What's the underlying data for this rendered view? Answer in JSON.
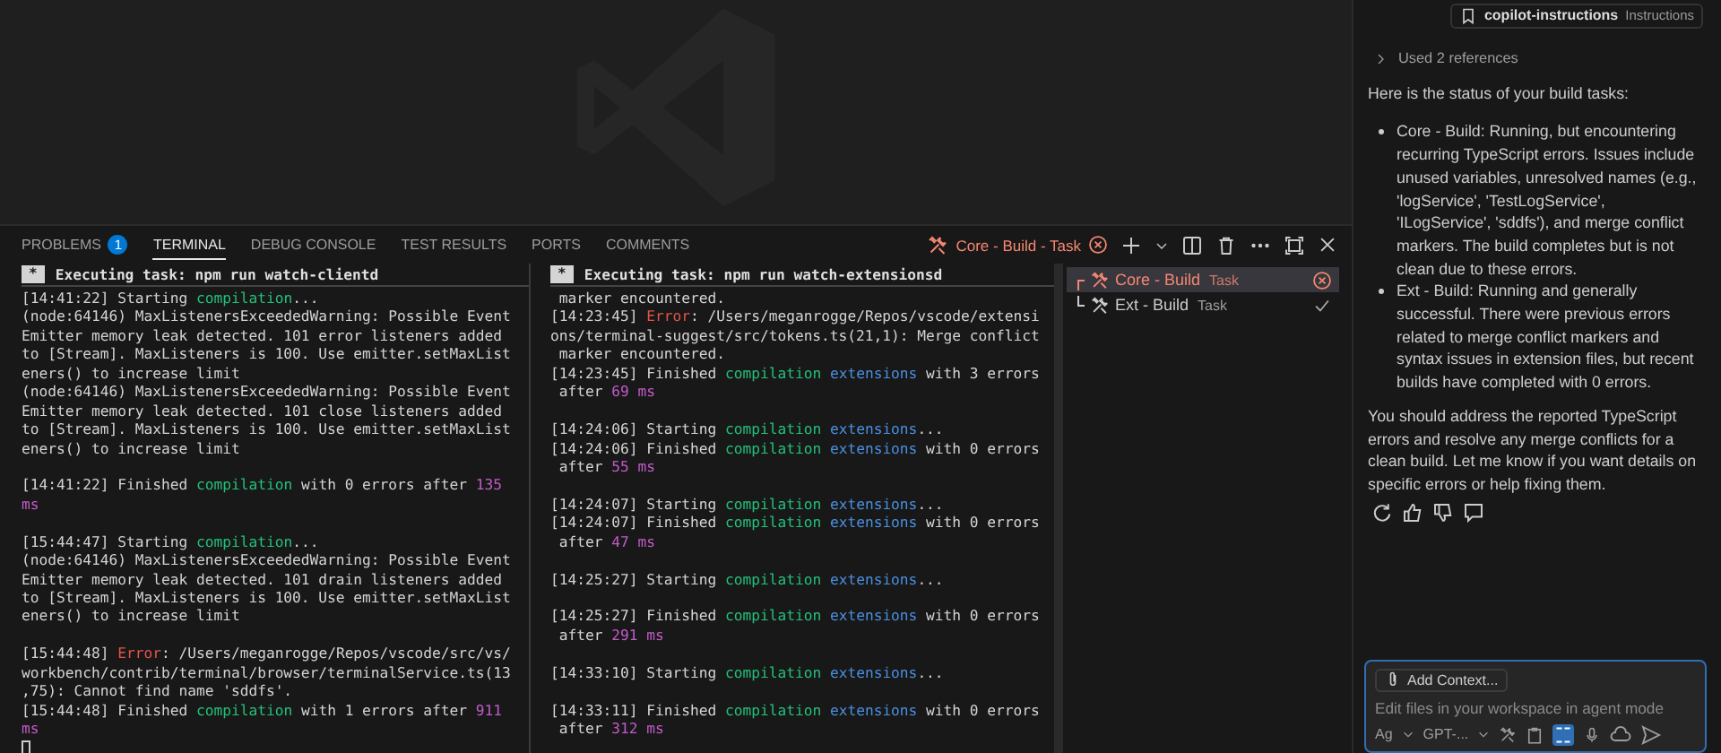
{
  "panel": {
    "tabs": [
      {
        "label": "PROBLEMS",
        "badge": "1",
        "selected": false
      },
      {
        "label": "TERMINAL",
        "selected": true
      },
      {
        "label": "DEBUG CONSOLE",
        "selected": false
      },
      {
        "label": "TEST RESULTS",
        "selected": false
      },
      {
        "label": "PORTS",
        "selected": false
      },
      {
        "label": "COMMENTS",
        "selected": false
      }
    ],
    "active_terminal": "Core - Build - Task",
    "terminals": [
      {
        "badge": "*",
        "header": "Executing task: npm run watch-clientd",
        "blocks": [
          [
            [
              {
                "text": "[14:41:22] Starting ",
                "kind": "plain"
              },
              {
                "text": "compilation",
                "kind": "green"
              },
              {
                "text": "...",
                "kind": "plain"
              }
            ],
            [
              {
                "text": "(node:64146) MaxListenersExceededWarning: Possible Event",
                "kind": "plain"
              }
            ],
            [
              {
                "text": "Emitter memory leak detected. 101 error listeners added",
                "kind": "plain"
              }
            ],
            [
              {
                "text": "to [Stream]. MaxListeners is 100. Use emitter.setMaxList",
                "kind": "plain"
              }
            ],
            [
              {
                "text": "eners() to increase limit",
                "kind": "plain"
              }
            ],
            [
              {
                "text": "(node:64146) MaxListenersExceededWarning: Possible Event",
                "kind": "plain"
              }
            ],
            [
              {
                "text": "Emitter memory leak detected. 101 close listeners added",
                "kind": "plain"
              }
            ],
            [
              {
                "text": "to [Stream]. MaxListeners is 100. Use emitter.setMaxList",
                "kind": "plain"
              }
            ],
            [
              {
                "text": "eners() to increase limit",
                "kind": "plain"
              }
            ]
          ],
          [
            [
              {
                "text": "[14:41:22] Finished ",
                "kind": "plain"
              },
              {
                "text": "compilation",
                "kind": "green"
              },
              {
                "text": " with 0 errors after ",
                "kind": "plain"
              },
              {
                "text": "135",
                "kind": "magenta"
              }
            ],
            [
              {
                "text": "ms",
                "kind": "magenta"
              }
            ]
          ],
          [
            [
              {
                "text": "[15:44:47] Starting ",
                "kind": "plain"
              },
              {
                "text": "compilation",
                "kind": "green"
              },
              {
                "text": "...",
                "kind": "plain"
              }
            ],
            [
              {
                "text": "(node:64146) MaxListenersExceededWarning: Possible Event",
                "kind": "plain"
              }
            ],
            [
              {
                "text": "Emitter memory leak detected. 101 drain listeners added",
                "kind": "plain"
              }
            ],
            [
              {
                "text": "to [Stream]. MaxListeners is 100. Use emitter.setMaxList",
                "kind": "plain"
              }
            ],
            [
              {
                "text": "eners() to increase limit",
                "kind": "plain"
              }
            ]
          ],
          [
            [
              {
                "text": "[15:44:48] ",
                "kind": "plain"
              },
              {
                "text": "Error",
                "kind": "red"
              },
              {
                "text": ": /Users/meganrogge/Repos/vscode/src/vs/",
                "kind": "plain"
              }
            ],
            [
              {
                "text": "workbench/contrib/terminal/browser/terminalService.ts(13",
                "kind": "plain"
              }
            ],
            [
              {
                "text": ",75): Cannot find name 'sddfs'.",
                "kind": "plain"
              }
            ],
            [
              {
                "text": "[15:44:48] Finished ",
                "kind": "plain"
              },
              {
                "text": "compilation",
                "kind": "green"
              },
              {
                "text": " with 1 errors after ",
                "kind": "plain"
              },
              {
                "text": "911",
                "kind": "magenta"
              }
            ],
            [
              {
                "text": "ms",
                "kind": "magenta"
              }
            ]
          ]
        ]
      },
      {
        "badge": "*",
        "header": "Executing task: npm run watch-extensionsd",
        "blocks": [
          [
            [
              {
                "text": " marker encountered.",
                "kind": "plain"
              }
            ],
            [
              {
                "text": "[14:23:45] ",
                "kind": "plain"
              },
              {
                "text": "Error",
                "kind": "red"
              },
              {
                "text": ": /Users/meganrogge/Repos/vscode/extensi",
                "kind": "plain"
              }
            ],
            [
              {
                "text": "ons/terminal-suggest/src/tokens.ts(21,1): Merge conflict",
                "kind": "plain"
              }
            ],
            [
              {
                "text": " marker encountered.",
                "kind": "plain"
              }
            ],
            [
              {
                "text": "[14:23:45] Finished ",
                "kind": "plain"
              },
              {
                "text": "compilation",
                "kind": "green"
              },
              {
                "text": " extensions",
                "kind": "blue"
              },
              {
                "text": " with 3 errors",
                "kind": "plain"
              }
            ],
            [
              {
                "text": " after ",
                "kind": "plain"
              },
              {
                "text": "69 ms",
                "kind": "magenta"
              }
            ]
          ],
          [
            [
              {
                "text": "[14:24:06] Starting ",
                "kind": "plain"
              },
              {
                "text": "compilation",
                "kind": "green"
              },
              {
                "text": " extensions",
                "kind": "blue"
              },
              {
                "text": "...",
                "kind": "plain"
              }
            ],
            [
              {
                "text": "[14:24:06] Finished ",
                "kind": "plain"
              },
              {
                "text": "compilation",
                "kind": "green"
              },
              {
                "text": " extensions",
                "kind": "blue"
              },
              {
                "text": " with 0 errors",
                "kind": "plain"
              }
            ],
            [
              {
                "text": " after ",
                "kind": "plain"
              },
              {
                "text": "55 ms",
                "kind": "magenta"
              }
            ]
          ],
          [
            [
              {
                "text": "[14:24:07] Starting ",
                "kind": "plain"
              },
              {
                "text": "compilation",
                "kind": "green"
              },
              {
                "text": " extensions",
                "kind": "blue"
              },
              {
                "text": "...",
                "kind": "plain"
              }
            ],
            [
              {
                "text": "[14:24:07] Finished ",
                "kind": "plain"
              },
              {
                "text": "compilation",
                "kind": "green"
              },
              {
                "text": " extensions",
                "kind": "blue"
              },
              {
                "text": " with 0 errors",
                "kind": "plain"
              }
            ],
            [
              {
                "text": " after ",
                "kind": "plain"
              },
              {
                "text": "47 ms",
                "kind": "magenta"
              }
            ]
          ],
          [
            [
              {
                "text": "[14:25:27] Starting ",
                "kind": "plain"
              },
              {
                "text": "compilation",
                "kind": "green"
              },
              {
                "text": " extensions",
                "kind": "blue"
              },
              {
                "text": "...",
                "kind": "plain"
              }
            ]
          ],
          [
            [
              {
                "text": "[14:25:27] Finished ",
                "kind": "plain"
              },
              {
                "text": "compilation",
                "kind": "green"
              },
              {
                "text": " extensions",
                "kind": "blue"
              },
              {
                "text": " with 0 errors",
                "kind": "plain"
              }
            ],
            [
              {
                "text": " after ",
                "kind": "plain"
              },
              {
                "text": "291 ms",
                "kind": "magenta"
              }
            ]
          ],
          [
            [
              {
                "text": "[14:33:10] Starting ",
                "kind": "plain"
              },
              {
                "text": "compilation",
                "kind": "green"
              },
              {
                "text": " extensions",
                "kind": "blue"
              },
              {
                "text": "...",
                "kind": "plain"
              }
            ]
          ],
          [
            [
              {
                "text": "[14:33:11] Finished ",
                "kind": "plain"
              },
              {
                "text": "compilation",
                "kind": "green"
              },
              {
                "text": " extensions",
                "kind": "blue"
              },
              {
                "text": " with 0 errors",
                "kind": "plain"
              }
            ],
            [
              {
                "text": " after ",
                "kind": "plain"
              },
              {
                "text": "312 ms",
                "kind": "magenta"
              }
            ]
          ]
        ]
      }
    ],
    "tasks": [
      {
        "name": "Core - Build",
        "type": "Task",
        "kind": "error",
        "selected": true
      },
      {
        "name": "Ext - Build",
        "type": "Task",
        "kind": "success",
        "selected": false
      }
    ]
  },
  "chat": {
    "instructions_chip": {
      "name": "copilot-instructions",
      "kind": "Instructions"
    },
    "references": "Used 2 references",
    "intro": "Here is the status of your build tasks:",
    "bullets": [
      "Core - Build: Running, but encountering recurring TypeScript errors. Issues include unused variables, unresolved names (e.g., 'logService', 'TestLogService', 'ILogService', 'sddfs'), and merge conflict markers. The build completes but is not clean due to these errors.",
      "Ext - Build: Running and generally successful. There were previous errors related to merge conflict markers and syntax issues in extension files, but recent builds have completed with 0 errors."
    ],
    "closing": "You should address the reported TypeScript errors and resolve any merge conflicts for a clean build. Let me know if you want details on specific errors or help fixing them.",
    "input": {
      "add_context": "Add Context...",
      "placeholder": "Edit files in your workspace in agent mode",
      "mode": "Ag",
      "model": "GPT-..."
    }
  }
}
